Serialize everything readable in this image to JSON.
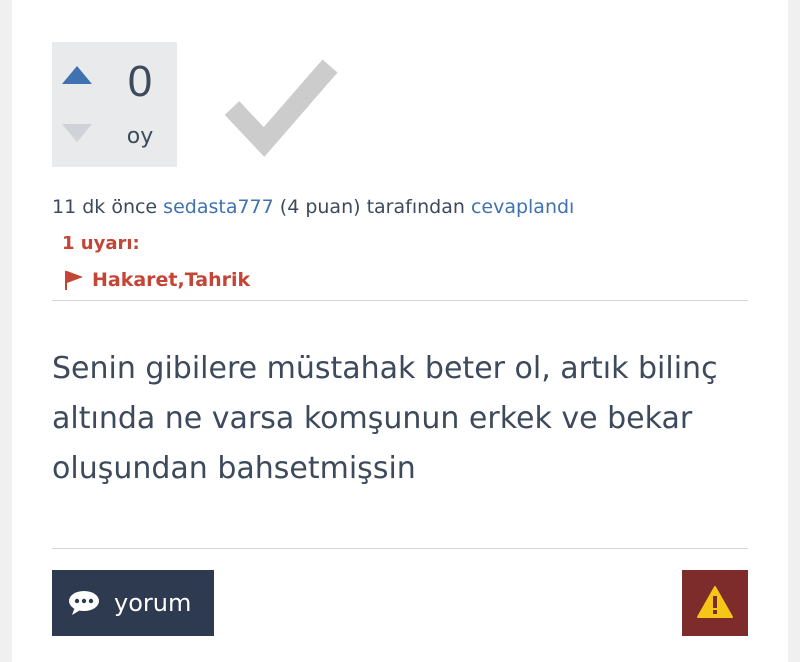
{
  "vote": {
    "count": "0",
    "label": "oy",
    "up_icon": "triangle-up-icon",
    "down_icon": "triangle-down-icon",
    "up_color": "#3f72af",
    "down_color": "#cfd2d6"
  },
  "best_answer": {
    "icon": "checkmark-icon",
    "color": "#cccccc"
  },
  "meta": {
    "time": "11 dk önce",
    "user": "sedasta777",
    "points": "(4 puan)",
    "by_text": "tarafından",
    "action": "cevaplandı"
  },
  "warning": {
    "title": "1 uyarı:",
    "flag_icon": "flag-icon",
    "reason": "Hakaret,Tahrik",
    "color": "#c44536"
  },
  "answer": {
    "text": "Senin gibilere müstahak beter ol, artık bilinç altında ne varsa komşunun erkek ve bekar oluşundan bahsetmişsin"
  },
  "actions": {
    "comment_label": "yorum",
    "comment_icon": "speech-bubble-icon",
    "report_icon": "warning-icon"
  },
  "colors": {
    "text": "#3d4a5c",
    "link": "#3f72af",
    "comment_button": "#2d3a4f",
    "report_button": "#7d2b2b",
    "report_icon_fill": "#f5c518"
  }
}
